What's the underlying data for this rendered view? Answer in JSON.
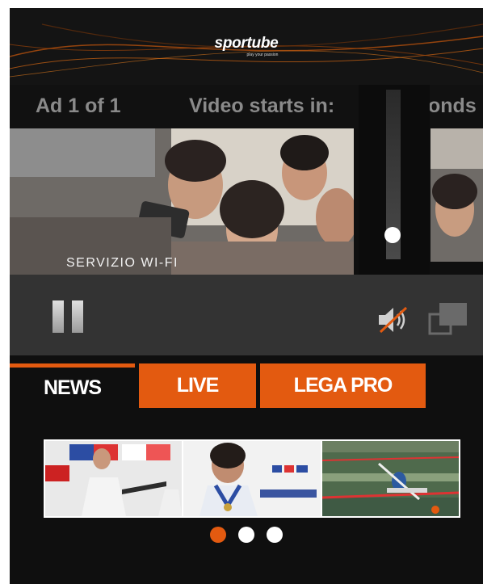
{
  "banner": {
    "logo": "sportube",
    "tagline": "play your passion"
  },
  "ad_bar": {
    "ad_count": "Ad 1 of 1",
    "countdown": "Video starts in:",
    "countdown_tail": "onds"
  },
  "video": {
    "caption": "SERVIZIO WI-FI"
  },
  "volume": {
    "level": 0.12
  },
  "controls": {
    "play_state": "paused",
    "muted": true
  },
  "tabs": [
    {
      "label": "NEWS",
      "active": true
    },
    {
      "label": "LIVE",
      "active": false
    },
    {
      "label": "LEGA PRO",
      "active": false
    }
  ],
  "carousel": {
    "slides": [
      "fencing-athlete",
      "fencer-with-medal",
      "canoe-race"
    ],
    "active_index": 0
  },
  "colors": {
    "accent": "#e35a10",
    "background": "#0f0f0f",
    "controls": "#333333"
  }
}
